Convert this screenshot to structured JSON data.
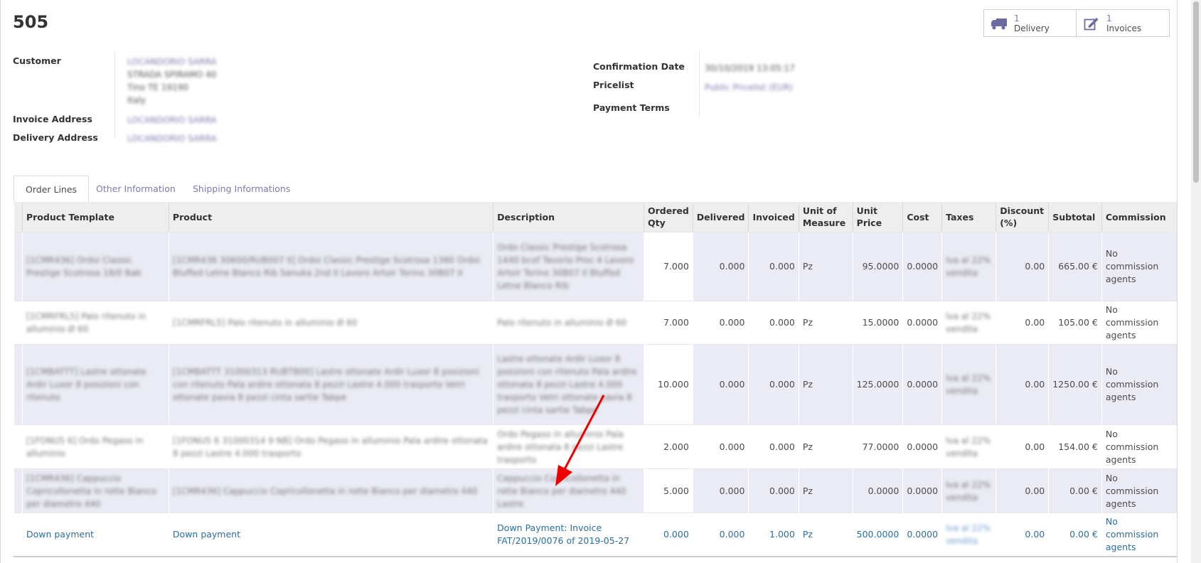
{
  "record": {
    "title": "505"
  },
  "smart_buttons": [
    {
      "count": "1",
      "label": "Delivery",
      "icon": "truck-icon"
    },
    {
      "count": "1",
      "label": "Invoices",
      "icon": "pencil-square-icon"
    }
  ],
  "fields": {
    "customer_label": "Customer",
    "invoice_address_label": "Invoice Address",
    "delivery_address_label": "Delivery Address",
    "confirmation_date_label": "Confirmation Date",
    "pricelist_label": "Pricelist",
    "payment_terms_label": "Payment Terms",
    "customer_value_lines": [
      "LOCANDORIO SARRA",
      "STRADA SPIRAMO 40",
      "Tino TE 19190",
      "Italy"
    ],
    "invoice_address_value": "LOCANDORIO SARRA",
    "delivery_address_value": "LOCANDORIO SARRA",
    "confirmation_date_value": "30/10/2019 13:05:17",
    "pricelist_value": "Public Pricelist (EUR)"
  },
  "tabs": [
    "Order Lines",
    "Other Information",
    "Shipping Informations"
  ],
  "table": {
    "headers": [
      "Product Template",
      "Product",
      "Description",
      "Ordered Qty",
      "Delivered",
      "Invoiced",
      "Unit of Measure",
      "Unit Price",
      "Cost",
      "Taxes",
      "Discount (%)",
      "Subtotal",
      "Commission"
    ],
    "rows": [
      {
        "template": "[1CMR436] Ordoi Classic Prestige Scotrosa 18/0 Bab",
        "product": "[1CMR436 30600/RUB007 II] Ordoi Classic Prestige Scotrosa 1380 Ordoi Bluffed Letne Blanco Rib Sanuka 2nd II Lavoro Artoir Torino 30B07 II",
        "description": "Ordo Classic Prestige Scotrosa 1440 bcof Tavorio Proc 4 Lavoro Artoir Torino 30B07 II Bluffed Letne Blanco Rib",
        "ordered": "7.000",
        "delivered": "0.000",
        "invoiced": "0.000",
        "uom": "Pz",
        "price": "95.0000",
        "cost": "0.0000",
        "taxes": "Iva al 22% vendita",
        "discount": "0.00",
        "subtotal": "665.00 €",
        "commission": "No commission agents"
      },
      {
        "template": "[1CMRFRL5] Palo ritenuto in alluminio Ø 60",
        "product": "[1CMRFRL5] Palo ritenuto in alluminio Ø 60",
        "description": "Palo ritenuto in alluminio Ø 60",
        "ordered": "7.000",
        "delivered": "0.000",
        "invoiced": "0.000",
        "uom": "Pz",
        "price": "15.0000",
        "cost": "0.0000",
        "taxes": "Iva al 22% vendita",
        "discount": "0.00",
        "subtotal": "105.00 €",
        "commission": "No commission agents"
      },
      {
        "template": "[1CMBATTT] Lastre ottonate Ardir Luxor 8 posizioni con ritenuto",
        "product": "[1CMBATTT 31000313 RUBTB00] Lastre ottonate Ardir Luxor 8 posizioni con ritenuto Pala ardire ottonata 8 pezzi Lastre 4.000 trasporto Vetri ottonate pavia 8 pezzi cinta sartie Tabpe",
        "description": "Lastre ottonate Ardir Luxor 8 posizioni con ritenuto Pala ardire ottonata 8 pezzi Lastre 4.000 trasporto Vetri ottonate pavia 8 pezzi cinta sartie Tabpe",
        "ordered": "10.000",
        "delivered": "0.000",
        "invoiced": "0.000",
        "uom": "Pz",
        "price": "125.0000",
        "cost": "0.0000",
        "taxes": "Iva al 22% vendita",
        "discount": "0.00",
        "subtotal": "1250.00 €",
        "commission": "No commission agents"
      },
      {
        "template": "[1FONU5 6] Ordo Pegaso in alluminio",
        "product": "[1FONU5 6 31000314 9 NB] Ordo Pegaso in alluminio Pala ardire ottonata 8 pezzi Lastre 4.000 trasporto",
        "description": "Ordo Pegaso in alluminio Pala ardire ottonata 8 pezzi Lastre trasporto",
        "ordered": "2.000",
        "delivered": "0.000",
        "invoiced": "0.000",
        "uom": "Pz",
        "price": "77.0000",
        "cost": "0.0000",
        "taxes": "Iva al 22% vendita",
        "discount": "0.00",
        "subtotal": "154.00 €",
        "commission": "No commission agents"
      },
      {
        "template": "[1CMR436] Cappuccio Copricollonetta in rotte Bianco per diametro 440",
        "product": "[1CMR436] Cappuccio Copricollonetta in rotte Bianco per diametro 440",
        "description": "Cappuccio Copricollonetta in rotte Bianco per diametro 440 Lastre",
        "ordered": "5.000",
        "delivered": "0.000",
        "invoiced": "0.000",
        "uom": "Pz",
        "price": "0.0000",
        "cost": "0.0000",
        "taxes": "Iva al 22% vendita",
        "discount": "0.00",
        "subtotal": "0.00 €",
        "commission": "No commission agents"
      },
      {
        "template": "Down payment",
        "product": "Down payment",
        "description": "Down Payment: Invoice FAT/2019/0076 of 2019-05-27",
        "ordered": "0.000",
        "delivered": "0.000",
        "invoiced": "1.000",
        "uom": "Pz",
        "price": "500.0000",
        "cost": "0.0000",
        "taxes": "Iva al 22% vendita",
        "discount": "0.00",
        "subtotal": "0.00 €",
        "commission": "No commission agents"
      }
    ]
  },
  "colors": {
    "link": "#7c7bad",
    "down_payment_text": "#2e6d9e",
    "row_shade": "#ebebf5",
    "arrow": "#ee0000"
  }
}
